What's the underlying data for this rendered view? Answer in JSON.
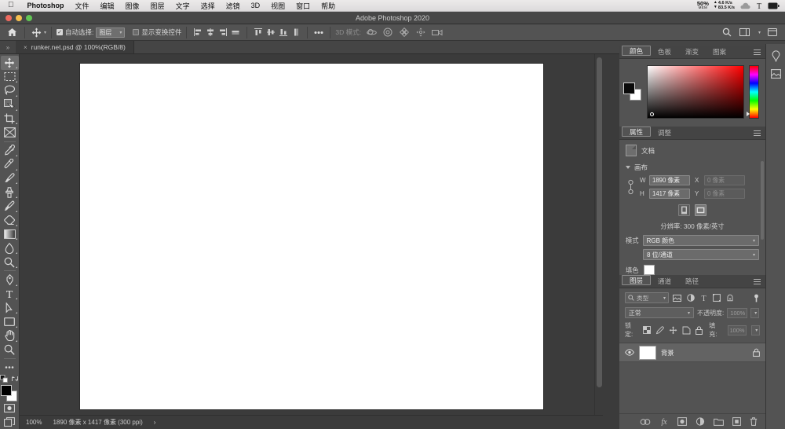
{
  "macmenu": {
    "apple_icon": "apple-icon",
    "items": [
      {
        "label": "Photoshop",
        "bold": true
      },
      {
        "label": "文件",
        "bold": false
      },
      {
        "label": "编辑",
        "bold": false
      },
      {
        "label": "图像",
        "bold": false
      },
      {
        "label": "图层",
        "bold": false
      },
      {
        "label": "文字",
        "bold": false
      },
      {
        "label": "选择",
        "bold": false
      },
      {
        "label": "滤镜",
        "bold": false
      },
      {
        "label": "3D",
        "bold": false
      },
      {
        "label": "视图",
        "bold": false
      },
      {
        "label": "窗口",
        "bold": false
      },
      {
        "label": "帮助",
        "bold": false
      }
    ],
    "status": {
      "memory_percent": "50%",
      "memory_label": "MEM",
      "net_up": "4.6 K/s",
      "net_down": "83.5 K/s",
      "icons": [
        "cloud-icon",
        "text-input-icon",
        "battery-icon"
      ]
    }
  },
  "titlebar": {
    "title": "Adobe Photoshop 2020",
    "buttons": [
      "close-button",
      "minimize-button",
      "maximize-button"
    ]
  },
  "optionsbar": {
    "home_icon": "home-icon",
    "tool_icon": "move-tool-icon",
    "auto_select_label": "自动选择:",
    "auto_select_checked": true,
    "auto_select_value": "图层",
    "show_transform_label": "显示变换控件",
    "show_transform_checked": false,
    "align_icons": [
      "align-left-icon",
      "align-center-h-icon",
      "align-right-icon",
      "distribute-h-icon",
      "align-top-icon",
      "align-middle-v-icon",
      "align-bottom-icon",
      "distribute-v-icon"
    ],
    "more_icon": "more-options-icon",
    "mode3d_label": "3D 模式:",
    "mode3d_icons": [
      "orbit-3d-icon",
      "roll-3d-icon",
      "pan-3d-icon",
      "slide-3d-icon",
      "camera-3d-icon"
    ],
    "right_icons": [
      "search-icon",
      "workspace-icon",
      "panels-icon"
    ]
  },
  "tabbar": {
    "overflow_icon": "chevron-overflow-icon",
    "document": {
      "close_icon": "close-tab-icon",
      "label": "runker.net.psd @ 100%(RGB/8)"
    }
  },
  "toolbox": {
    "tools": [
      {
        "name": "move-tool",
        "active": true,
        "flyout": true
      },
      {
        "name": "rectangular-marquee-tool",
        "active": false,
        "flyout": true
      },
      {
        "name": "lasso-tool",
        "active": false,
        "flyout": true
      },
      {
        "name": "quick-selection-tool",
        "active": false,
        "flyout": true
      },
      {
        "name": "crop-tool",
        "active": false,
        "flyout": true
      },
      {
        "name": "frame-tool",
        "active": false,
        "flyout": false
      },
      {
        "name": "eyedropper-tool",
        "active": false,
        "flyout": true
      },
      {
        "name": "spot-healing-brush-tool",
        "active": false,
        "flyout": true
      },
      {
        "name": "brush-tool",
        "active": false,
        "flyout": true
      },
      {
        "name": "clone-stamp-tool",
        "active": false,
        "flyout": true
      },
      {
        "name": "history-brush-tool",
        "active": false,
        "flyout": true
      },
      {
        "name": "eraser-tool",
        "active": false,
        "flyout": true
      },
      {
        "name": "gradient-tool",
        "active": false,
        "flyout": true
      },
      {
        "name": "blur-tool",
        "active": false,
        "flyout": true
      },
      {
        "name": "dodge-tool",
        "active": false,
        "flyout": true
      },
      {
        "name": "pen-tool",
        "active": false,
        "flyout": true
      },
      {
        "name": "type-tool",
        "active": false,
        "flyout": true
      },
      {
        "name": "path-selection-tool",
        "active": false,
        "flyout": true
      },
      {
        "name": "rectangle-shape-tool",
        "active": false,
        "flyout": true
      },
      {
        "name": "hand-tool",
        "active": false,
        "flyout": true
      },
      {
        "name": "zoom-tool",
        "active": false,
        "flyout": false
      },
      {
        "name": "edit-toolbar-tool",
        "active": false,
        "flyout": false
      }
    ],
    "foreground_color": "#000000",
    "background_color": "#ffffff",
    "quickmask_icon": "quick-mask-icon",
    "screenmode_icon": "screen-mode-icon"
  },
  "statusbar": {
    "zoom": "100%",
    "doc_info": "1890 像素 x 1417 像素 (300 ppi)",
    "chevron": "›"
  },
  "color_panel": {
    "tabs": [
      {
        "label": "颜色",
        "selected": true
      },
      {
        "label": "色板",
        "selected": false
      },
      {
        "label": "渐变",
        "selected": false
      },
      {
        "label": "图案",
        "selected": false
      }
    ],
    "foreground": "#000000",
    "background": "#ffffff",
    "field_hue": "#ff0000"
  },
  "properties_panel": {
    "tabs": [
      {
        "label": "属性",
        "selected": true
      },
      {
        "label": "调整",
        "selected": false
      }
    ],
    "doc_row_label": "文档",
    "section_label": "画布",
    "width_label": "W",
    "width_value": "1890 像素",
    "height_label": "H",
    "height_value": "1417 像素",
    "x_label": "X",
    "x_placeholder": "0 像素",
    "y_label": "Y",
    "y_placeholder": "0 像素",
    "orientation_portrait": "portrait-orientation-icon",
    "orientation_landscape": "landscape-orientation-icon",
    "resolution_text": "分辨率: 300 像素/英寸",
    "mode_label": "模式",
    "mode_value": "RGB 颜色",
    "depth_value": "8 位/通道",
    "fill_label": "填色",
    "fill_color": "#ffffff"
  },
  "layers_panel": {
    "tabs": [
      {
        "label": "图层",
        "selected": true
      },
      {
        "label": "通道",
        "selected": false
      },
      {
        "label": "路径",
        "selected": false
      }
    ],
    "filter_label": "类型",
    "filter_icons": [
      "filter-pixel-icon",
      "filter-adjustment-icon",
      "filter-type-icon",
      "filter-shape-icon",
      "filter-smart-icon"
    ],
    "filter_toggle": "filter-toggle-icon",
    "blend_mode": "正常",
    "opacity_label": "不透明度:",
    "opacity_value": "100%",
    "lock_label": "锁定:",
    "lock_icons": [
      "lock-transparent-icon",
      "lock-image-icon",
      "lock-position-icon",
      "lock-artboard-icon",
      "lock-all-icon"
    ],
    "fill_label": "填充:",
    "fill_value": "100%",
    "layers": [
      {
        "name": "背景",
        "visible": true,
        "locked": true,
        "thumb_color": "#ffffff"
      }
    ],
    "footer_icons": [
      "link-layers-icon",
      "layer-style-icon",
      "layer-mask-icon",
      "adjustment-layer-icon",
      "new-group-icon",
      "new-layer-icon",
      "delete-layer-icon"
    ]
  },
  "right_rail": {
    "icons": [
      "color-picker-rail-icon",
      "library-rail-icon"
    ]
  }
}
